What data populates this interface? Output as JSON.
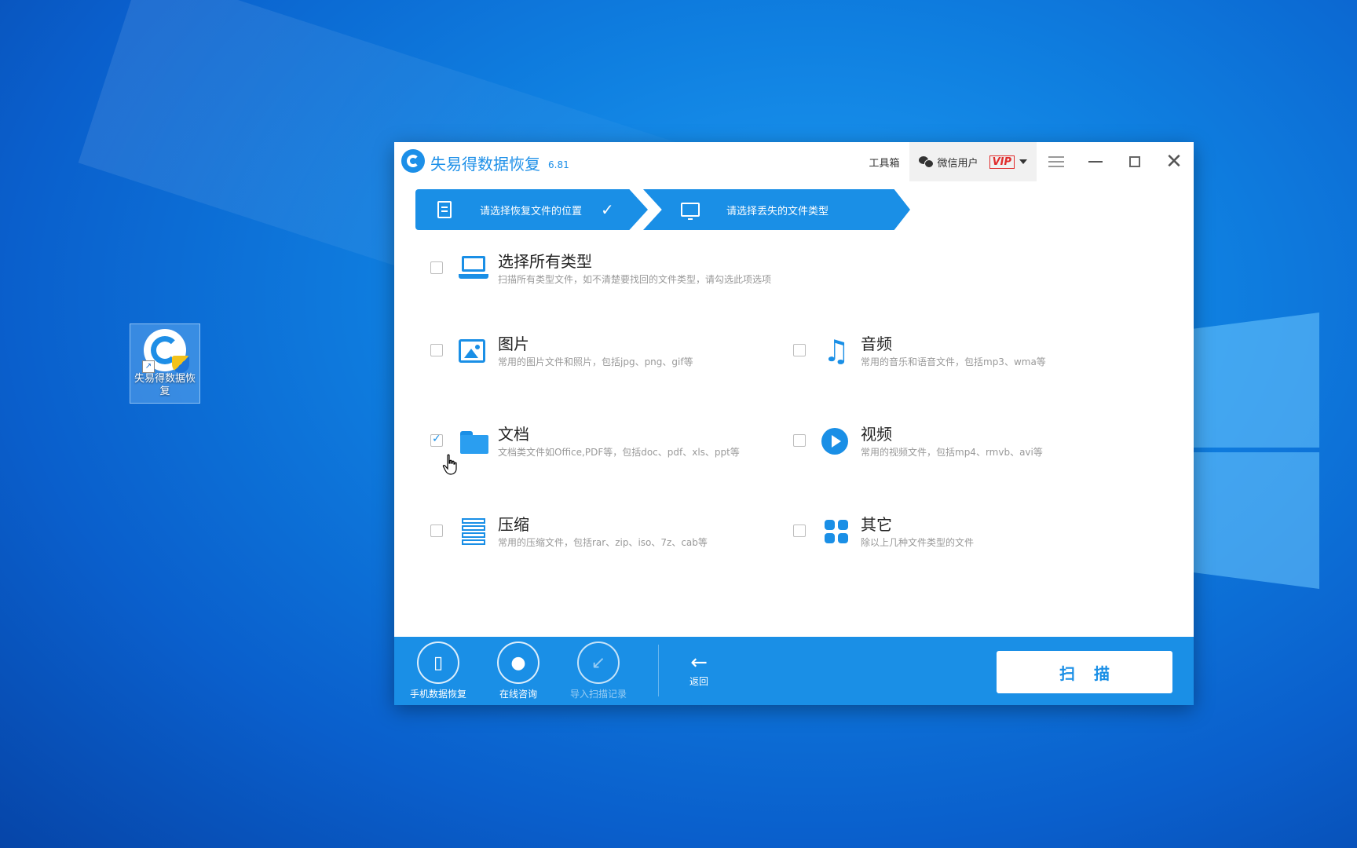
{
  "desktop": {
    "icon_label": "失易得数据恢复"
  },
  "app": {
    "title": "失易得数据恢复",
    "version": "6.81",
    "toolbox_label": "工具箱",
    "user_label": "微信用户",
    "vip_label": "VIP"
  },
  "steps": [
    {
      "label": "请选择恢复文件的位置",
      "done": true
    },
    {
      "label": "请选择丢失的文件类型",
      "done": false
    }
  ],
  "options": {
    "all": {
      "title": "选择所有类型",
      "desc": "扫描所有类型文件，如不清楚要找回的文件类型，请勾选此项选项",
      "checked": false
    },
    "picture": {
      "title": "图片",
      "desc": "常用的图片文件和照片，包括jpg、png、gif等",
      "checked": false
    },
    "audio": {
      "title": "音频",
      "desc": "常用的音乐和语音文件，包括mp3、wma等",
      "checked": false
    },
    "document": {
      "title": "文档",
      "desc": "文档类文件如Office,PDF等，包括doc、pdf、xls、ppt等",
      "checked": true
    },
    "video": {
      "title": "视频",
      "desc": "常用的视频文件，包括mp4、rmvb、avi等",
      "checked": false
    },
    "archive": {
      "title": "压缩",
      "desc": "常用的压缩文件，包括rar、zip、iso、7z、cab等",
      "checked": false
    },
    "other": {
      "title": "其它",
      "desc": "除以上几种文件类型的文件",
      "checked": false
    }
  },
  "bottom": {
    "phone_recovery": "手机数据恢复",
    "online_consult": "在线咨询",
    "import_record": "导入扫描记录",
    "back": "返回",
    "scan": "扫描"
  },
  "colors": {
    "accent": "#1a8fe6",
    "desktop": "#0f7fe0"
  }
}
